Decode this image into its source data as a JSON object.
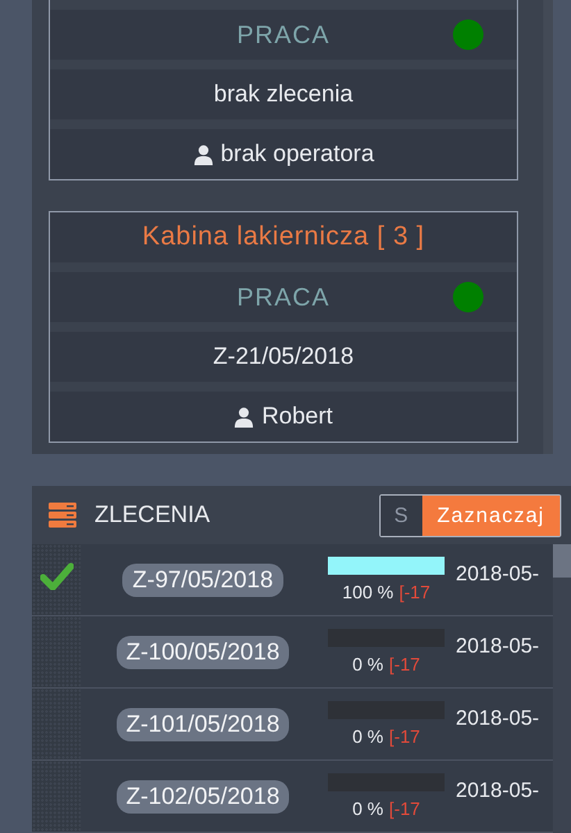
{
  "machines": [
    {
      "status": "PRACA",
      "color": "#008000",
      "order": "brak zlecenia",
      "operator": "brak operatora"
    },
    {
      "title": "Kabina lakiernicza [ 3 ]",
      "status": "PRACA",
      "color": "#008000",
      "order": "Z-21/05/2018",
      "operator": "Robert"
    }
  ],
  "orders": {
    "title": "ZLECENIA",
    "toggle": [
      {
        "label": "S",
        "selected": false
      },
      {
        "label": "Zaznaczaj",
        "selected": true
      }
    ],
    "rows": [
      {
        "checked": true,
        "number": "Z-97/05/2018",
        "level": 1,
        "percent": "100 %",
        "deadline": "[-17",
        "date": "2018-05-"
      },
      {
        "checked": false,
        "number": "Z-100/05/2018",
        "level": 0,
        "percent": "0 %",
        "deadline": "[-17",
        "date": "2018-05-"
      },
      {
        "checked": false,
        "number": "Z-101/05/2018",
        "level": 0,
        "percent": "0 %",
        "deadline": "[-17",
        "date": "2018-05-"
      },
      {
        "checked": false,
        "number": "Z-102/05/2018",
        "level": 0,
        "percent": "0 %",
        "deadline": "[-17",
        "date": "2018-05-"
      }
    ]
  }
}
